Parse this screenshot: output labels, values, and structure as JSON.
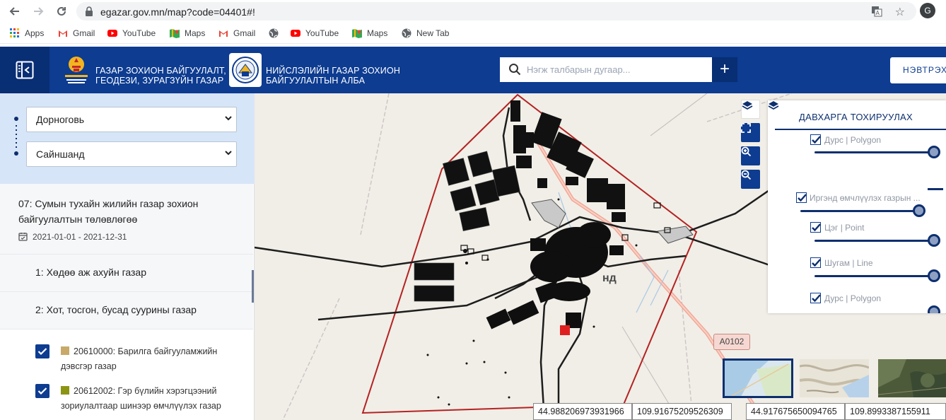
{
  "browser": {
    "url": "egazar.gov.mn/map?code=04401#!",
    "profile_initial": "G",
    "bookmarks": [
      {
        "label": "Apps",
        "icon": "apps-grid-icon"
      },
      {
        "label": "Gmail",
        "icon": "gmail-icon"
      },
      {
        "label": "YouTube",
        "icon": "youtube-icon"
      },
      {
        "label": "Maps",
        "icon": "maps-icon"
      },
      {
        "label": "Gmail",
        "icon": "gmail-icon"
      },
      {
        "label": "",
        "icon": "globe-icon"
      },
      {
        "label": "YouTube",
        "icon": "youtube-icon"
      },
      {
        "label": "Maps",
        "icon": "maps-icon"
      },
      {
        "label": "New Tab",
        "icon": "globe-icon"
      }
    ]
  },
  "header": {
    "org1": [
      "ГАЗАР ЗОХИОН БАЙГУУЛАЛТ,",
      "ГЕОДЕЗИ, ЗУРАГЗҮЙН ГАЗАР"
    ],
    "org2": [
      "НИЙСЛЭЛИЙН ГАЗАР ЗОХИОН",
      "БАЙГУУЛАЛТЫН АЛБА"
    ],
    "search_placeholder": "Нэгж талбарын дугаар...",
    "add_label": "+",
    "login_label": "НЭВТРЭХ",
    "brand_color": "#0d3c91"
  },
  "sidebar": {
    "province": "Дорноговь",
    "soum": "Сайншанд",
    "plan_title": "07: Сумын тухайн жилийн газар зохион байгуулалтын төлөвлөгөө",
    "plan_date": "2021-01-01 - 2021-12-31",
    "categories": [
      "1: Хөдөө аж ахуйн газар",
      "2: Хот, тосгон, бусад суурины газар"
    ],
    "checks": [
      {
        "label": "20610000: Барилга байгууламжийн дэвсгэр газар",
        "color": "#c8a96a",
        "checked": true
      },
      {
        "label": "20612002: Гэр бүлийн хэрэгцээний зориулалтаар шинээр өмчлүүлэх газар",
        "color": "#8c9413",
        "checked": true
      }
    ]
  },
  "map": {
    "road_label": "A0102",
    "place_label": "нд",
    "coords": [
      "44.988206973931966",
      "109.91675209526309",
      "44.917675650094765",
      "109.8993387155911"
    ]
  },
  "layers": {
    "title": "ДАВХАРГА ТОХИРУУЛАХ",
    "items": [
      {
        "label": "Дурс | Polygon",
        "checked": true
      },
      {
        "label": "Иргэнд өмчлүүлэх газрын ...",
        "checked": true
      },
      {
        "label": "Цэг | Point",
        "checked": true
      },
      {
        "label": "Шугам | Line",
        "checked": true
      },
      {
        "label": "Дурс | Polygon",
        "checked": true
      }
    ]
  }
}
